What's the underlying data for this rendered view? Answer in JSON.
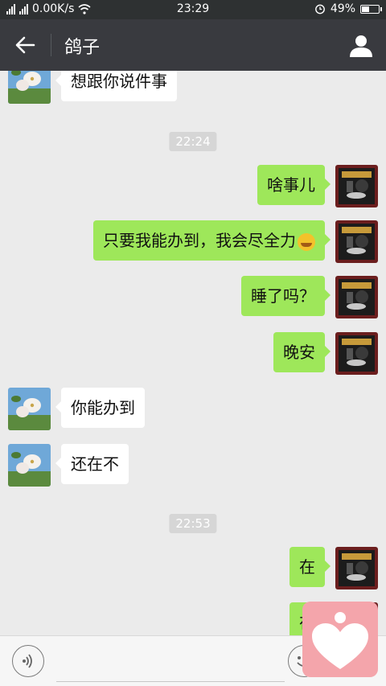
{
  "status_bar": {
    "network_speed": "0.00K/s",
    "time": "23:29",
    "battery": "49%",
    "battery_level": 0.49,
    "icons": [
      "signal-icon",
      "signal-icon",
      "wifi-icon",
      "alarm-icon",
      "battery-icon"
    ]
  },
  "header": {
    "title": "鸽子",
    "back_icon": "back-arrow-icon",
    "profile_icon": "person-icon"
  },
  "chat": {
    "messages": [
      {
        "side": "in",
        "text": "想跟你说件事"
      },
      {
        "type": "time",
        "text": "22:24"
      },
      {
        "side": "out",
        "text": "啥事儿"
      },
      {
        "side": "out",
        "text": "只要我能办到，我会尽全力",
        "emoji": "laughing-tears-emoji"
      },
      {
        "side": "out",
        "text": "睡了吗？"
      },
      {
        "side": "out",
        "text": "晚安"
      },
      {
        "side": "in",
        "text": "你能办到"
      },
      {
        "side": "in",
        "text": "还在不"
      },
      {
        "type": "time",
        "text": "22:53"
      },
      {
        "side": "out",
        "text": "在"
      },
      {
        "side": "out",
        "text": "在"
      }
    ]
  },
  "input_bar": {
    "voice_icon": "voice-icon",
    "text_value": "",
    "emoji_icon": "emoji-icon"
  },
  "overlay": {
    "icon": "heart-icon",
    "color": "#f4a5ab"
  },
  "colors": {
    "header": "#393a3f",
    "status_bar": "#2e3132",
    "background": "#ebebeb",
    "outgoing_bubble": "#9ee75a",
    "incoming_bubble": "#ffffff"
  }
}
